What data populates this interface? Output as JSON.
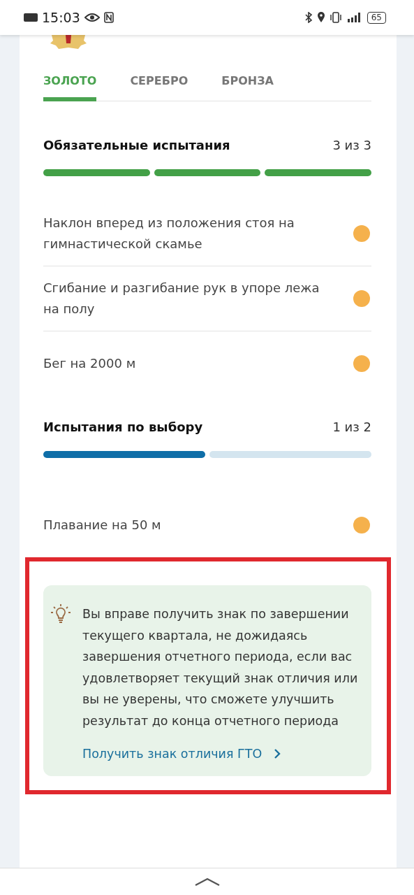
{
  "status_bar": {
    "time": "15:03",
    "battery": "65"
  },
  "tabs": [
    {
      "label": "ЗОЛОТО",
      "selected": true
    },
    {
      "label": "СЕРЕБРО",
      "selected": false
    },
    {
      "label": "БРОНЗА",
      "selected": false
    }
  ],
  "sections": [
    {
      "title": "Обязательные испытания",
      "count": "3 из 3",
      "color": "#43a047",
      "segments": [
        {
          "done": true
        },
        {
          "done": true
        },
        {
          "done": true
        }
      ],
      "items": [
        {
          "name": "Наклон вперед из положения стоя на гимнастической скамье",
          "color": "#f5b14c"
        },
        {
          "name": "Сгибание и разгибание рук в упоре лежа на полу",
          "color": "#f5b14c"
        },
        {
          "name": "Бег на 2000 м",
          "color": "#f5b14c"
        }
      ]
    },
    {
      "title": "Испытания по выбору",
      "count": "1 из 2",
      "color": "#0f6ea8",
      "segments": [
        {
          "done": true
        },
        {
          "done": false
        }
      ],
      "items": [
        {
          "name": "Плавание на 50 м",
          "color": "#f5b14c"
        }
      ]
    }
  ],
  "tip": {
    "text": "Вы вправе получить знак по завершении текущего квартала, не дожидаясь завершения отчетного периода, если вас удовлетворяет текущий знак отличия или вы не уверены, что сможете улучшить результат до конца отчетного периода",
    "link": "Получить знак отличия ГТО",
    "highlighted": true
  }
}
